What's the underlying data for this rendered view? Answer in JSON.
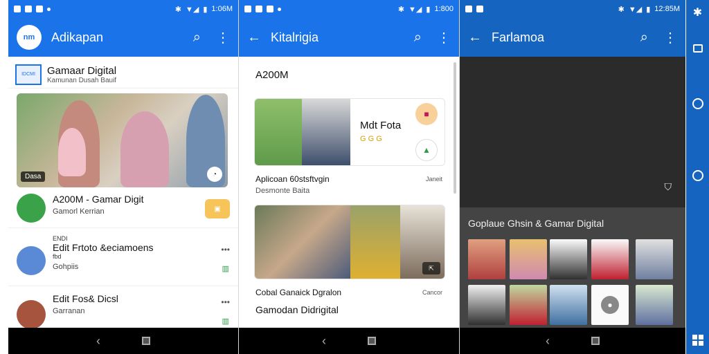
{
  "panels": [
    {
      "status": {
        "time": "1:06M"
      },
      "appbar": {
        "logo": "nm",
        "title": "Adikapan"
      },
      "header_card": {
        "title": "Gamaar Digital",
        "subtitle": "Kamunan Dusah Bauif",
        "badge": "IDCMI"
      },
      "photo": {
        "tag": "Dasa"
      },
      "rows": [
        {
          "title": "A200M - Gamar Digit",
          "subtitle": "Gamorl Kerrian"
        },
        {
          "small": "ENDI",
          "title": "Edit Frtoto &eciamoens",
          "small2": "fbd",
          "subtitle": "Gohpiis"
        },
        {
          "title": "Edit Fos& Dicsl",
          "subtitle": "Garranan"
        }
      ]
    },
    {
      "status": {
        "time": "1:800"
      },
      "appbar": {
        "title": "Kitalrigia"
      },
      "subtitle": "A200M",
      "card_a": {
        "label": "Mdt Fota",
        "dots": "G G G"
      },
      "caption_a": "Aplicoan 60stsftvgin",
      "meta_a_left": "Desmonte Baita",
      "meta_a_right": "Janeit",
      "caption_b": "Cobal Ganaick Dgralon",
      "meta_b_right": "Cancor",
      "footer": "Gamodan Didrigital"
    },
    {
      "status": {
        "time": "12:85M"
      },
      "appbar": {
        "title": "Farlamoa"
      },
      "gallery_title": "Goplaue Ghsin & Gamar Digital"
    }
  ],
  "colors": {
    "accent": "#1a73e8",
    "accent_dark": "#1565c0",
    "dark_bg": "#2e2e2e"
  }
}
